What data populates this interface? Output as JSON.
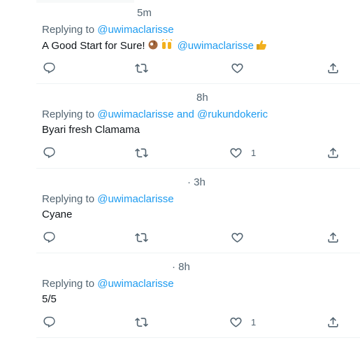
{
  "tweets": [
    {
      "time": "5m",
      "replying_prefix": "Replying to",
      "mentions": [
        "@uwimaclarisse"
      ],
      "joiner": "",
      "text": "A Good Start for Sure!",
      "text_mention": "@uwimaclarisse",
      "emojis": [
        "ok-hand-emoji",
        "raised-hands-emoji",
        "thumbs-up-emoji"
      ],
      "like_count": ""
    },
    {
      "time": "8h",
      "replying_prefix": "Replying to",
      "mentions": [
        "@uwimaclarisse",
        "@rukundokeric"
      ],
      "joiner": "and",
      "text": "Byari fresh Clamama",
      "like_count": "1"
    },
    {
      "time": "· 3h",
      "replying_prefix": "Replying to",
      "mentions": [
        "@uwimaclarisse"
      ],
      "joiner": "",
      "text": "Cyane",
      "like_count": ""
    },
    {
      "time": "· 8h",
      "replying_prefix": "Replying to",
      "mentions": [
        "@uwimaclarisse"
      ],
      "joiner": "",
      "text": "5/5",
      "like_count": "1"
    }
  ],
  "icons": {
    "reply": "reply-icon",
    "retweet": "retweet-icon",
    "like": "heart-icon",
    "share": "share-icon"
  },
  "colors": {
    "text": "#0f1419",
    "muted": "#536471",
    "link": "#1d9bf0",
    "divider": "#eff3f4"
  }
}
